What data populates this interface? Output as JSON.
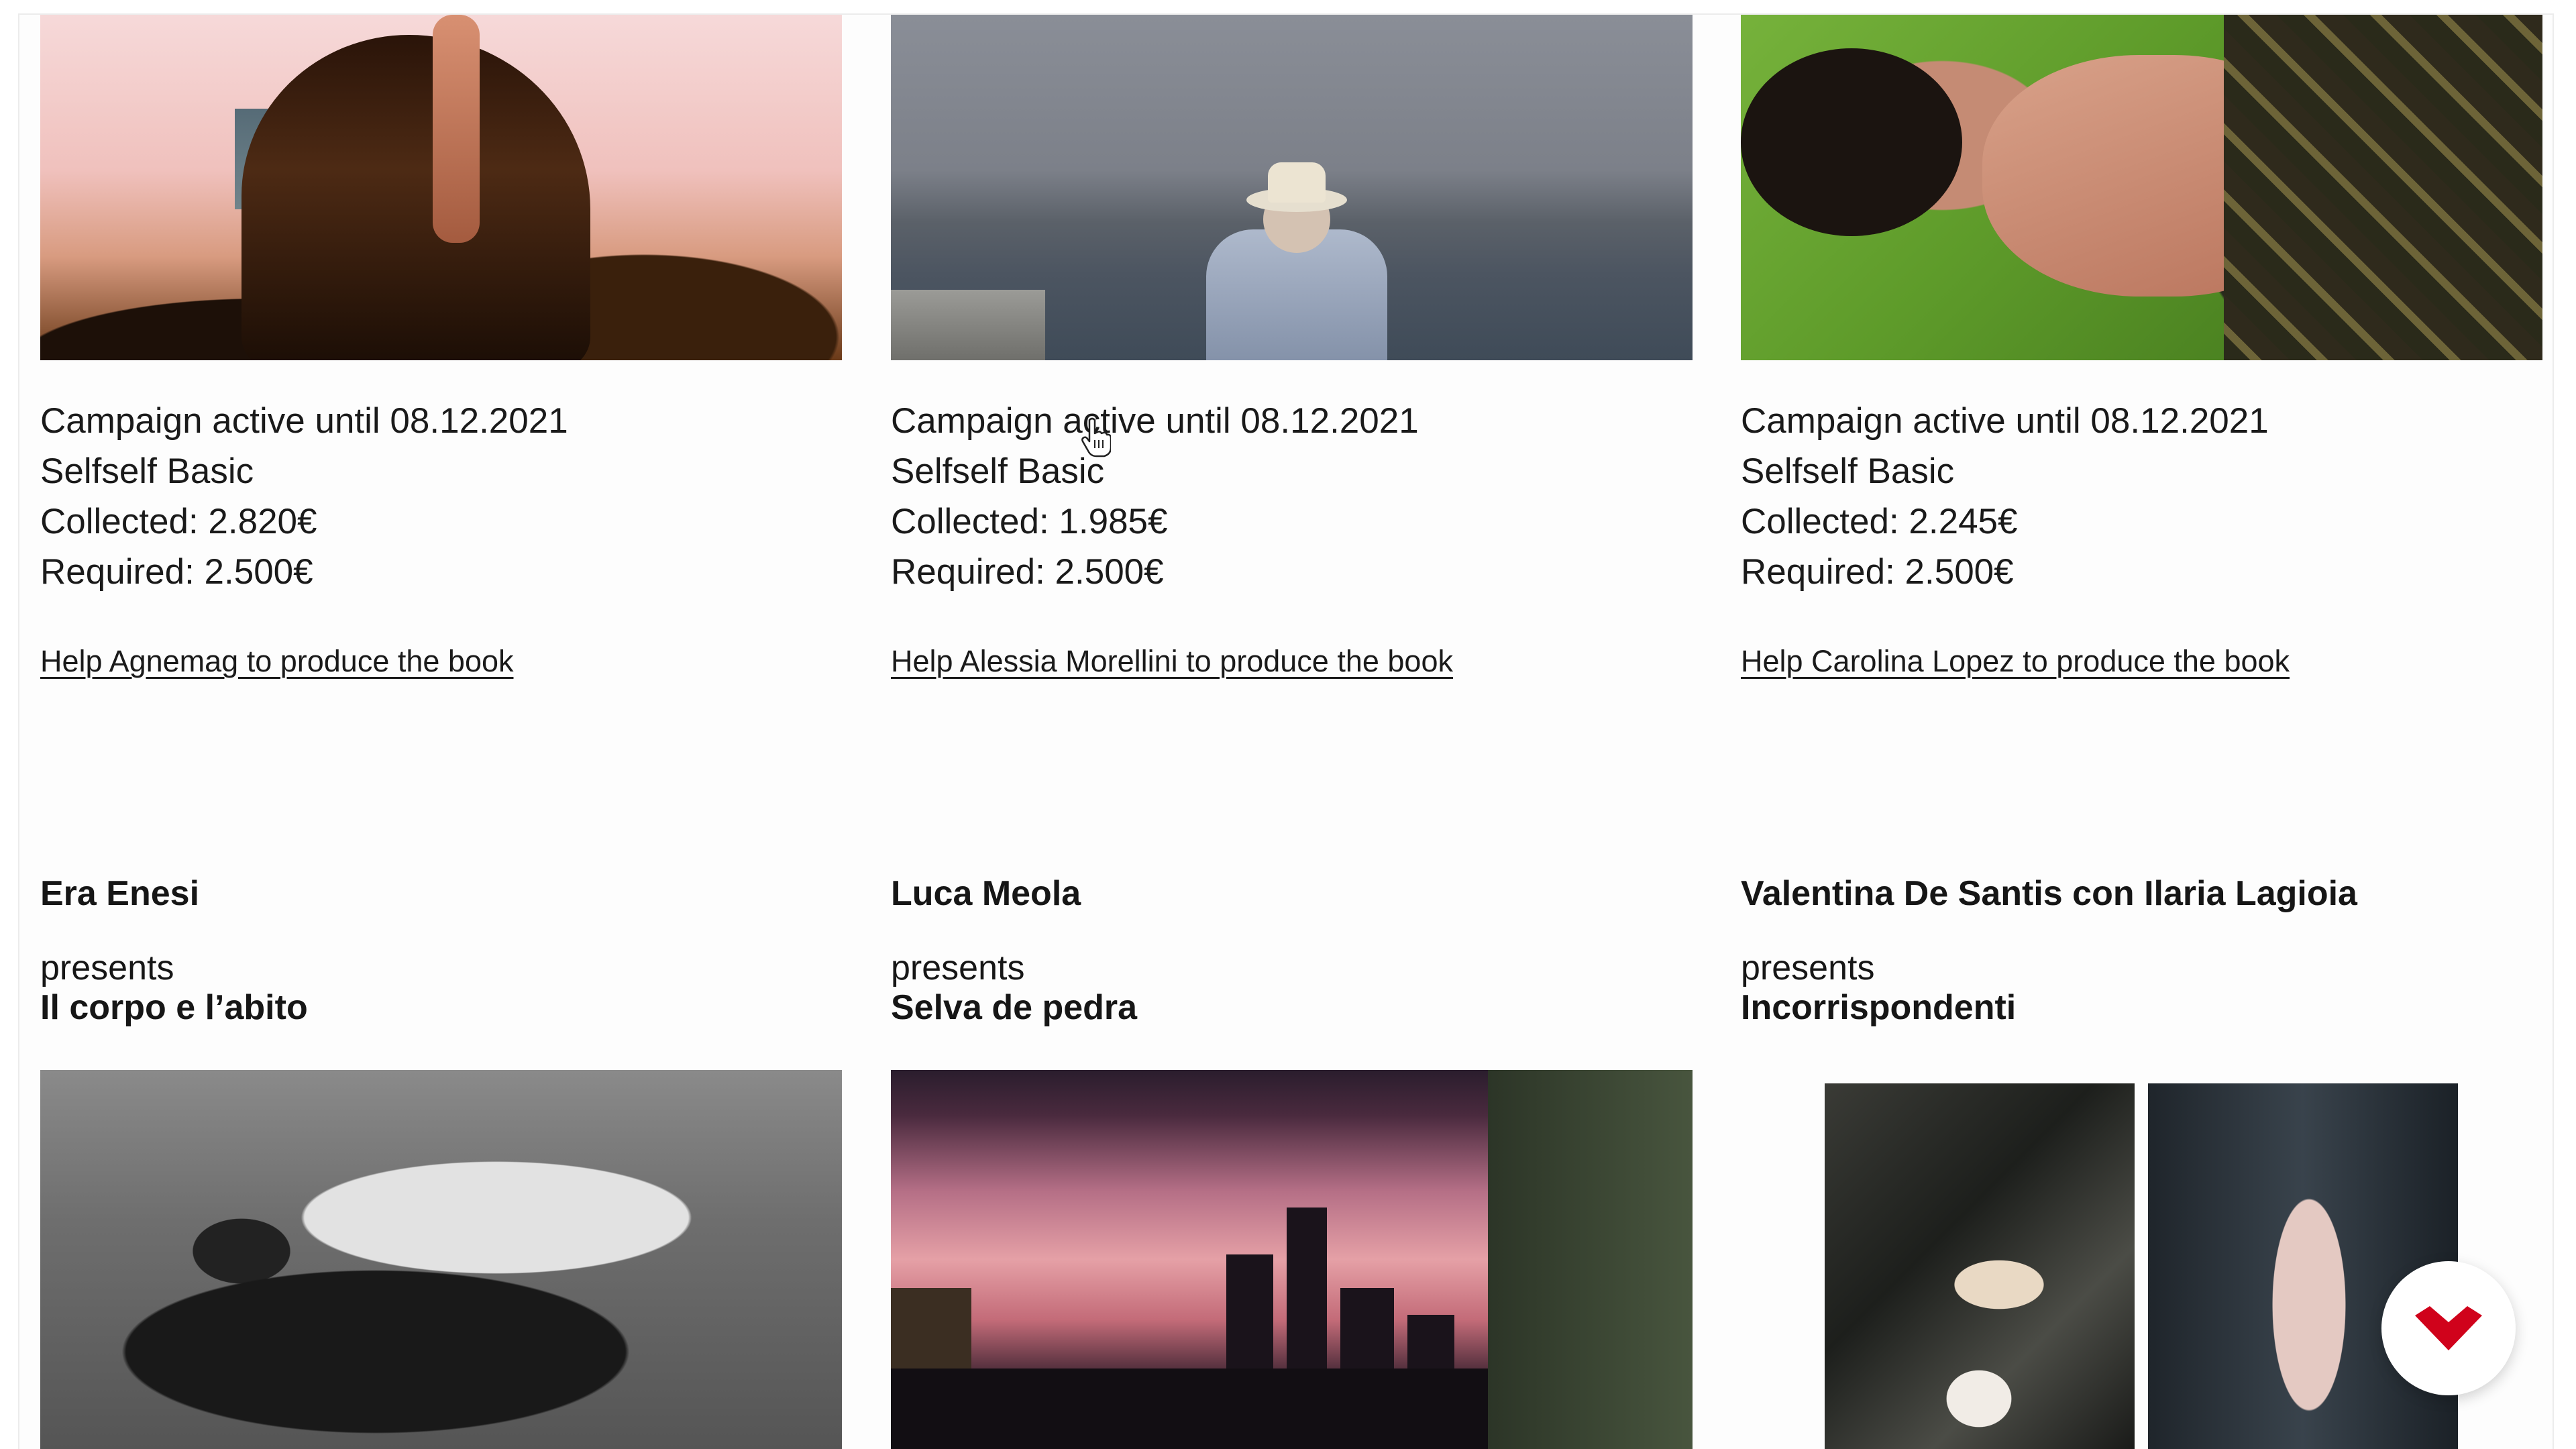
{
  "campaigns": [
    {
      "status": "Campaign active until 08.12.2021",
      "plan": "Selfself Basic",
      "collected": "Collected: 2.820€",
      "required": "Required: 2.500€",
      "link": "Help Agnemag to produce the book"
    },
    {
      "status": "Campaign active until 08.12.2021",
      "plan": "Selfself Basic",
      "collected": "Collected: 1.985€",
      "required": "Required: 2.500€",
      "link": "Help Alessia Morellini to produce the book"
    },
    {
      "status": "Campaign active until 08.12.2021",
      "plan": "Selfself Basic",
      "collected": "Collected: 2.245€",
      "required": "Required: 2.500€",
      "link": "Help Carolina Lopez to produce the book"
    }
  ],
  "projects": [
    {
      "author": "Era Enesi",
      "presents": "presents",
      "title": "Il corpo e l’abito"
    },
    {
      "author": "Luca Meola",
      "presents": "presents",
      "title": "Selva de pedra"
    },
    {
      "author": "Valentina De Santis con Ilaria Lagioia",
      "presents": "presents",
      "title": "Incorrispondenti"
    }
  ],
  "colors": {
    "brand_red": "#d0021b",
    "text": "#1a1a1a"
  },
  "icons": {
    "fab": "chevron-heart-icon",
    "cursor": "hand-pointer-icon"
  }
}
